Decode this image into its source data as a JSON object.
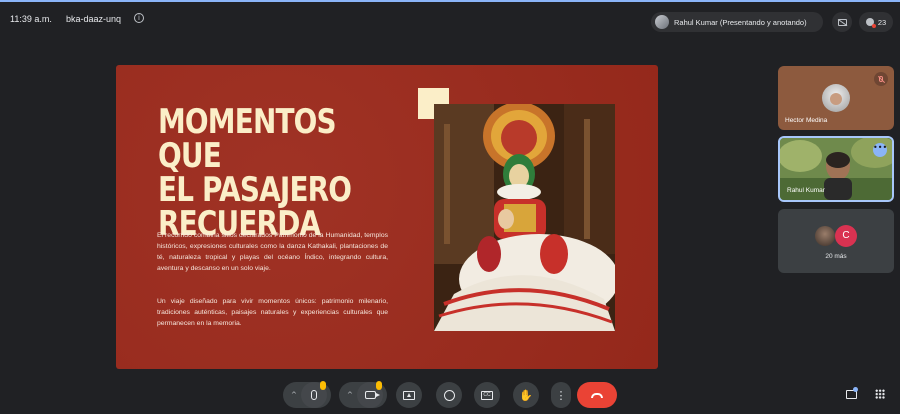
{
  "header": {
    "time": "11:39 a.m.",
    "meeting_code": "bka-daaz-unq",
    "info_icon": "info-icon",
    "presenter_chip": "Rahul Kumar (Presentando y anotando)",
    "participant_count": "23"
  },
  "slide": {
    "title": "MOMENTOS QUE\nEL PASAJERO\nRECUERDA",
    "paragraph_1": "El recorrido combina sitios declarados Patrimonio de la Humanidad, templos históricos, expresiones culturales como la danza Kathakali, plantaciones de té, naturaleza tropical y playas del océano Índico, integrando cultura, aventura y descanso en un solo viaje.",
    "paragraph_2": "Un viaje diseñado para vivir momentos únicos: patrimonio milenario, tradiciones auténticas, paisajes naturales y experiencias culturales que permanecen en la memoria.",
    "background_color": "#9c2a1c",
    "title_color": "#fbeec8",
    "image_subject": "kathakali-dancer-photo"
  },
  "participants": {
    "tile_1": {
      "name": "Hector Medina",
      "muted": true
    },
    "tile_2": {
      "name": "Rahul Kumar"
    },
    "tile_3": {
      "avatar_letter": "C",
      "label": "20 más"
    }
  },
  "controls": {
    "items": [
      "mic-icon",
      "camera-icon",
      "present-icon",
      "emoji-icon",
      "captions-icon",
      "raise-hand-icon",
      "more-options-icon",
      "leave-call-icon"
    ],
    "leave_color": "#ea4335",
    "captions_label": "CC",
    "raise_hand_glyph": "✋",
    "more_glyph": "⋮",
    "more_options_glyph": "•••"
  },
  "side_buttons": [
    "chat-icon",
    "activities-icon"
  ]
}
